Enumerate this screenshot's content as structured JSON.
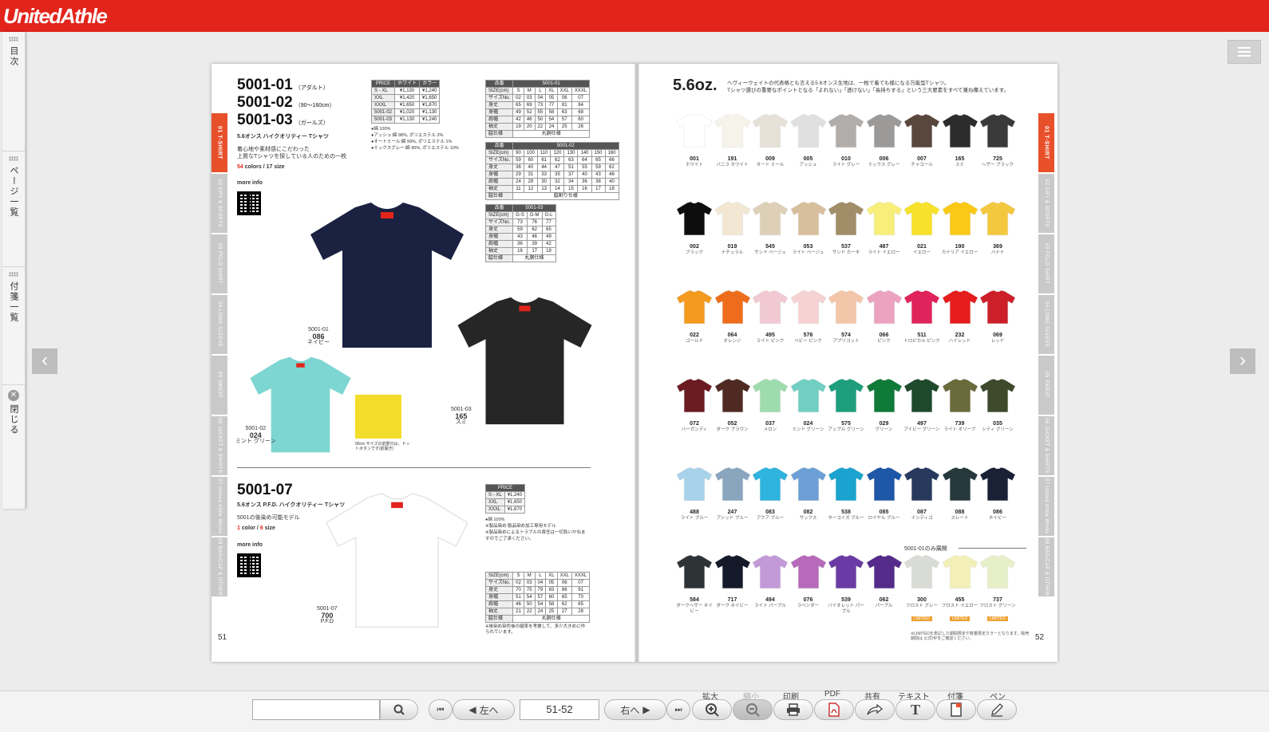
{
  "app": {
    "logo": "UnitedAthle"
  },
  "sidebar": {
    "tabs": [
      {
        "label": "目次"
      },
      {
        "label": "ページ一覧"
      },
      {
        "label": "付箋一覧"
      },
      {
        "label": "閉じる"
      }
    ]
  },
  "book": {
    "left": {
      "category_tabs": [
        "01 T-SHIRT",
        "02 DRY & SPORTS",
        "03 POLO SHIRT",
        "04 LONG SLEEVE",
        "05 SWEAT",
        "06 JACKET & SHIRTS",
        "07 United Athle Works",
        "08 BAG/CAP & OTHER"
      ],
      "product1": {
        "models": [
          {
            "code": "5001-01",
            "suffix": "（アダルト）"
          },
          {
            "code": "5001-02",
            "suffix": "（90〜160cm）"
          },
          {
            "code": "5001-03",
            "suffix": "（ガールズ）"
          }
        ],
        "name": "5.6オンス ハイクオリティー Tシャツ",
        "desc1": "着心地や素材感にこだわった",
        "desc2": "上質なTシャツを探している人のための一枚",
        "colors_num": "54",
        "colors_text": " colors / 17 size",
        "more_info": "more info",
        "material": [
          "●綿 100%",
          "●アッシュ:綿 98%, ポリエステル 2%",
          "●オートミール:綿 99%, ポリエステル 1%",
          "●ミックスグレー:綿 90%, ポリエステル 10%"
        ],
        "price_table": {
          "head": [
            "PRICE",
            "ホワイト",
            "カラー"
          ],
          "rows": [
            [
              "S - XL",
              "¥1,130",
              "¥1,240"
            ],
            [
              "XXL",
              "¥1,420",
              "¥1,650"
            ],
            [
              "XXXL",
              "¥1,650",
              "¥1,870"
            ],
            [
              "5001-02",
              "¥1,020",
              "¥1,130"
            ],
            [
              "5001-03",
              "¥1,130",
              "¥1,240"
            ]
          ]
        },
        "size_table_01": {
          "head": [
            "品番",
            "5001-01"
          ],
          "rows": [
            [
              "SIZE(cm)",
              "S",
              "M",
              "L",
              "XL",
              "XXL",
              "XXXL"
            ],
            [
              "サイズNo.",
              "02",
              "03",
              "04",
              "05",
              "06",
              "07"
            ],
            [
              "身丈",
              "65",
              "69",
              "73",
              "77",
              "81",
              "84"
            ],
            [
              "身幅",
              "49",
              "52",
              "55",
              "58",
              "63",
              "68"
            ],
            [
              "肩幅",
              "42",
              "46",
              "50",
              "54",
              "57",
              "60"
            ],
            [
              "袖丈",
              "19",
              "20",
              "22",
              "24",
              "25",
              "26"
            ],
            [
              "脇仕様",
              "丸胴仕様"
            ]
          ]
        },
        "size_table_02": {
          "head": [
            "品番",
            "5001-02"
          ],
          "rows": [
            [
              "SIZE(cm)",
              "90",
              "100",
              "110",
              "120",
              "130",
              "140",
              "150",
              "160"
            ],
            [
              "サイズNo.",
              "59",
              "60",
              "61",
              "62",
              "63",
              "64",
              "65",
              "66"
            ],
            [
              "身丈",
              "36",
              "40",
              "44",
              "47",
              "51",
              "55",
              "59",
              "62"
            ],
            [
              "身幅",
              "29",
              "31",
              "33",
              "35",
              "37",
              "40",
              "43",
              "46"
            ],
            [
              "肩幅",
              "24",
              "28",
              "30",
              "32",
              "34",
              "36",
              "38",
              "40"
            ],
            [
              "袖丈",
              "11",
              "12",
              "13",
              "14",
              "15",
              "16",
              "17",
              "18"
            ],
            [
              "脇仕様",
              "脇割り仕様"
            ]
          ]
        },
        "size_table_03": {
          "head": [
            "品番",
            "5001-03"
          ],
          "rows": [
            [
              "SIZE(cm)",
              "G-S",
              "G-M",
              "G-L"
            ],
            [
              "サイズNo.",
              "73",
              "76",
              "77"
            ],
            [
              "身丈",
              "59",
              "62",
              "65"
            ],
            [
              "身幅",
              "43",
              "46",
              "49"
            ],
            [
              "肩幅",
              "36",
              "39",
              "42"
            ],
            [
              "袖丈",
              "16",
              "17",
              "18"
            ],
            [
              "脇仕様",
              "丸胴仕様"
            ]
          ]
        },
        "shirts": [
          {
            "model": "5001-01",
            "code": "086",
            "name": "ネイビー",
            "color": "#1b2140"
          },
          {
            "model": "5001-03",
            "code": "165",
            "name": "スミ",
            "color": "#262626"
          },
          {
            "model": "5001-02",
            "code": "024",
            "name": "ミント グリーン",
            "color": "#7ed6d2"
          }
        ],
        "detail_note": "90cm サイズの前部分は、ドットボタンです(前開き)"
      },
      "product2": {
        "code": "5001-07",
        "name": "5.6オンス P.F.D. ハイクオリティー Tシャツ",
        "desc": "5001の後染め可能モデル",
        "colors_num": "1",
        "colors_text": " color / ",
        "size_num": "6",
        "size_text": " size",
        "more_info": "more info",
        "material": [
          "●綿 100%",
          "※製品染め:製品染め加工専用モデル",
          "※製品染めによるトラブルの責任は一切負いかねますのでご了承ください。"
        ],
        "price_table": {
          "head": [
            "PRICE"
          ],
          "rows": [
            [
              "S - XL",
              "¥1,240"
            ],
            [
              "XXL",
              "¥1,650"
            ],
            [
              "XXXL",
              "¥1,870"
            ]
          ]
        },
        "size_table": {
          "rows": [
            [
              "SIZE(cm)",
              "S",
              "M",
              "L",
              "XL",
              "XXL",
              "XXXL"
            ],
            [
              "サイズNo.",
              "02",
              "03",
              "04",
              "05",
              "06",
              "07"
            ],
            [
              "身丈",
              "70",
              "75",
              "79",
              "83",
              "86",
              "91"
            ],
            [
              "身幅",
              "51",
              "54",
              "57",
              "60",
              "65",
              "70"
            ],
            [
              "肩幅",
              "46",
              "50",
              "54",
              "58",
              "62",
              "65"
            ],
            [
              "袖丈",
              "21",
              "22",
              "24",
              "25",
              "27",
              "28"
            ],
            [
              "脇仕様",
              "丸胴仕様"
            ]
          ]
        },
        "shirt": {
          "model": "5001-07",
          "code": "700",
          "name": "P.F.D",
          "color": "#ffffff"
        },
        "note": "※後染め染色後の縮率を考慮して、多少大きめに作られています。"
      },
      "page_number": "51"
    },
    "right": {
      "title": "5.6oz.",
      "desc1": "ヘヴィーウェイトの代表格とも言える5.6オンス生地は、一枚で着ても様になる万能型Tシャツ。",
      "desc2": "Tシャツ選びの重要なポイントとなる「よれない」「透けない」「長持ちする」という三大要素をすべて兼ね備えています。",
      "only_label": "5001-01のみ展開",
      "limited_label": "LIMITED",
      "page_number": "52",
      "foot_note": "※LIMITEDを表記した期間限定や数量限定カラーとなります。販売期間は 公式HPをご確認ください。",
      "swatches": [
        [
          {
            "code": "001",
            "name": "ホワイト",
            "color": "#ffffff"
          },
          {
            "code": "191",
            "name": "バニラ ホワイト",
            "color": "#f6f3ea"
          },
          {
            "code": "009",
            "name": "オート ミール",
            "color": "#e6e1d7"
          },
          {
            "code": "005",
            "name": "アッシュ",
            "color": "#e0e0e0"
          },
          {
            "code": "010",
            "name": "ライト グレー",
            "color": "#b1adab"
          },
          {
            "code": "006",
            "name": "ミックス グレー",
            "color": "#9c9a99"
          },
          {
            "code": "007",
            "name": "チャコール",
            "color": "#59463d"
          },
          {
            "code": "165",
            "name": "スミ",
            "color": "#2c2c2c"
          },
          {
            "code": "725",
            "name": "ヘザー ブラック",
            "color": "#3a3a3a"
          }
        ],
        [
          {
            "code": "002",
            "name": "ブラック",
            "color": "#0d0d0d"
          },
          {
            "code": "019",
            "name": "ナチュラル",
            "color": "#f2e7d3"
          },
          {
            "code": "545",
            "name": "サンド ベージュ",
            "color": "#ddd0b7"
          },
          {
            "code": "053",
            "name": "ライト ベージュ",
            "color": "#d7be9c"
          },
          {
            "code": "537",
            "name": "サンド カーキ",
            "color": "#a18e69"
          },
          {
            "code": "487",
            "name": "ライト イエロー",
            "color": "#f7ef7a"
          },
          {
            "code": "021",
            "name": "イエロー",
            "color": "#f7e12a"
          },
          {
            "code": "190",
            "name": "カナリア イエロー",
            "color": "#f9c916"
          },
          {
            "code": "369",
            "name": "バナナ",
            "color": "#f4c83e"
          }
        ],
        [
          {
            "code": "022",
            "name": "ゴールド",
            "color": "#f39a1f"
          },
          {
            "code": "064",
            "name": "オレンジ",
            "color": "#ee6d1c"
          },
          {
            "code": "495",
            "name": "ライト ピンク",
            "color": "#f0c9d3"
          },
          {
            "code": "576",
            "name": "ベビー ピンク",
            "color": "#f6d2d2"
          },
          {
            "code": "574",
            "name": "アプリコット",
            "color": "#f4c6a9"
          },
          {
            "code": "066",
            "name": "ピンク",
            "color": "#eba3bf"
          },
          {
            "code": "511",
            "name": "トロピカル ピンク",
            "color": "#e0235a"
          },
          {
            "code": "232",
            "name": "ハイレッド",
            "color": "#e51d1d"
          },
          {
            "code": "069",
            "name": "レッド",
            "color": "#cc1f2a"
          }
        ],
        [
          {
            "code": "072",
            "name": "バーガンディ",
            "color": "#6b1b22"
          },
          {
            "code": "052",
            "name": "ダーク ブラウン",
            "color": "#4f2a23"
          },
          {
            "code": "037",
            "name": "メロン",
            "color": "#9fdcad"
          },
          {
            "code": "024",
            "name": "ミント グリーン",
            "color": "#71cfc2"
          },
          {
            "code": "575",
            "name": "アップル グリーン",
            "color": "#1e9e7c"
          },
          {
            "code": "029",
            "name": "グリーン",
            "color": "#107a38"
          },
          {
            "code": "497",
            "name": "アイビー グリーン",
            "color": "#1e4a2b"
          },
          {
            "code": "739",
            "name": "ライト オリーブ",
            "color": "#6b6a3c"
          },
          {
            "code": "035",
            "name": "シティ グリーン",
            "color": "#3d4a2b"
          }
        ],
        [
          {
            "code": "488",
            "name": "ライト ブルー",
            "color": "#a8d2ea"
          },
          {
            "code": "247",
            "name": "アシッド ブルー",
            "color": "#8aa6bf"
          },
          {
            "code": "083",
            "name": "アクア ブルー",
            "color": "#2fb3df"
          },
          {
            "code": "082",
            "name": "サックス",
            "color": "#6c9fd6"
          },
          {
            "code": "538",
            "name": "ターコイズ ブルー",
            "color": "#1aa3cf"
          },
          {
            "code": "085",
            "name": "ロイヤル ブルー",
            "color": "#1e56a8"
          },
          {
            "code": "087",
            "name": "インディゴ",
            "color": "#273a5e"
          },
          {
            "code": "088",
            "name": "スレート",
            "color": "#26383c"
          },
          {
            "code": "086",
            "name": "ネイビー",
            "color": "#1a2036"
          }
        ],
        [
          {
            "code": "584",
            "name": "ダークヘザー ネイビー",
            "color": "#2e3436"
          },
          {
            "code": "717",
            "name": "ダーク ネイビー",
            "color": "#151a2b"
          },
          {
            "code": "494",
            "name": "ライト パープル",
            "color": "#c29ad8"
          },
          {
            "code": "076",
            "name": "ラベンダー",
            "color": "#b76ab9"
          },
          {
            "code": "539",
            "name": "バイオレット パープル",
            "color": "#6a3ba4"
          },
          {
            "code": "062",
            "name": "パープル",
            "color": "#542b8a"
          },
          {
            "code": "300",
            "name": "フロスト グレー",
            "color": "#d9dbd7",
            "limited": true
          },
          {
            "code": "455",
            "name": "フロスト イエロー",
            "color": "#f2f0b7",
            "limited": true
          },
          {
            "code": "737",
            "name": "フロスト グリーン",
            "color": "#e7efc9",
            "limited": true
          }
        ]
      ]
    }
  },
  "toolbar": {
    "search_value": "",
    "first_page": "⏮",
    "prev_label": "左へ",
    "page_value": "51-52",
    "next_label": "右へ",
    "last_page": "⏭",
    "captions": [
      "拡大",
      "縮小",
      "印刷",
      "PDF",
      "共有",
      "テキスト",
      "付箋",
      "ペン"
    ]
  }
}
